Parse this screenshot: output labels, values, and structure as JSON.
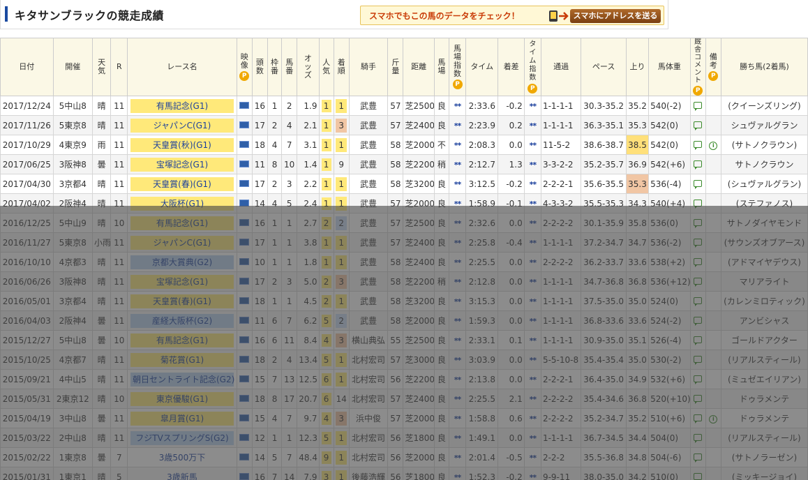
{
  "page": {
    "title": "キタサンブラックの競走成績",
    "banner_text": "スマホでもこの馬のデータをチェック！",
    "banner_button": "スマホにアドレスを送る",
    "p_badge": "P"
  },
  "colors": {
    "accent": "#1b4aa0",
    "highlight_yellow": "#ffe97a",
    "header_bg": "#fbf8e6",
    "link": "#1a3f9c"
  },
  "columns": {
    "date": "日付",
    "venue": "開催",
    "weather": "天気",
    "race_no": "R",
    "race_name": "レース名",
    "video": "映像",
    "field": "頭数",
    "waku": "枠番",
    "umaban": "馬番",
    "odds": "オッズ",
    "ninki": "人気",
    "chakujun": "着順",
    "jockey": "騎手",
    "kinryo": "斤量",
    "distance": "距離",
    "baba": "馬場",
    "baba_index": "馬場指数",
    "time": "タイム",
    "margin": "着差",
    "time_index": "タイム指数",
    "passing": "通過",
    "pace": "ペース",
    "agari": "上り",
    "weight": "馬体重",
    "comment": "厩舎コメント",
    "note": "備考",
    "winner": "勝ち馬(2着馬)"
  },
  "rows": [
    {
      "date": "2017/12/24",
      "venue": "5中山8",
      "weather": "晴",
      "r": "11",
      "name": "有馬記念(G1)",
      "grade": "g1",
      "field": "16",
      "waku": "1",
      "umaban": "2",
      "odds": "1.9",
      "ninki": "1",
      "chaku": "1",
      "chaku_cls": "win",
      "jockey": "武豊",
      "kinryo": "57",
      "distance": "芝2500",
      "baba": "良",
      "bidx": "**",
      "time": "2:33.6",
      "margin": "-0.2",
      "tidx": "**",
      "passing": "1-1-1-1",
      "pace": "30.3-35.2",
      "agari": "35.2",
      "agari_cls": "",
      "weight": "540(-2)",
      "note": "",
      "winner": "(クイーンズリング)"
    },
    {
      "date": "2017/11/26",
      "venue": "5東京8",
      "weather": "晴",
      "r": "11",
      "name": "ジャパンC(G1)",
      "grade": "g1",
      "field": "17",
      "waku": "2",
      "umaban": "4",
      "odds": "2.1",
      "ninki": "1",
      "chaku": "3",
      "chaku_cls": "third",
      "jockey": "武豊",
      "kinryo": "57",
      "distance": "芝2400",
      "baba": "良",
      "bidx": "**",
      "time": "2:23.9",
      "margin": "0.2",
      "tidx": "**",
      "passing": "1-1-1-1",
      "pace": "36.3-35.1",
      "agari": "35.3",
      "agari_cls": "",
      "weight": "542(0)",
      "note": "",
      "winner": "シュヴァルグラン"
    },
    {
      "date": "2017/10/29",
      "venue": "4東京9",
      "weather": "雨",
      "r": "11",
      "name": "天皇賞(秋)(G1)",
      "grade": "g1",
      "field": "18",
      "waku": "4",
      "umaban": "7",
      "odds": "3.1",
      "ninki": "1",
      "chaku": "1",
      "chaku_cls": "win",
      "jockey": "武豊",
      "kinryo": "58",
      "distance": "芝2000",
      "baba": "不",
      "bidx": "**",
      "time": "2:08.3",
      "margin": "0.0",
      "tidx": "**",
      "passing": "11-5-2",
      "pace": "38.6-38.7",
      "agari": "38.5",
      "agari_cls": "agari-hi",
      "weight": "542(0)",
      "note": "i",
      "winner": "(サトノクラウン)"
    },
    {
      "date": "2017/06/25",
      "venue": "3阪神8",
      "weather": "曇",
      "r": "11",
      "name": "宝塚記念(G1)",
      "grade": "g1",
      "field": "11",
      "waku": "8",
      "umaban": "10",
      "odds": "1.4",
      "ninki": "1",
      "chaku": "9",
      "chaku_cls": "",
      "jockey": "武豊",
      "kinryo": "58",
      "distance": "芝2200",
      "baba": "稍",
      "bidx": "**",
      "time": "2:12.7",
      "margin": "1.3",
      "tidx": "**",
      "passing": "3-3-2-2",
      "pace": "35.2-35.7",
      "agari": "36.9",
      "agari_cls": "",
      "weight": "542(+6)",
      "note": "",
      "winner": "サトノクラウン"
    },
    {
      "date": "2017/04/30",
      "venue": "3京都4",
      "weather": "晴",
      "r": "11",
      "name": "天皇賞(春)(G1)",
      "grade": "g1",
      "field": "17",
      "waku": "2",
      "umaban": "3",
      "odds": "2.2",
      "ninki": "1",
      "chaku": "1",
      "chaku_cls": "win",
      "jockey": "武豊",
      "kinryo": "58",
      "distance": "芝3200",
      "baba": "良",
      "bidx": "**",
      "time": "3:12.5",
      "margin": "-0.2",
      "tidx": "**",
      "passing": "2-2-2-1",
      "pace": "35.6-35.5",
      "agari": "35.3",
      "agari_cls": "agari-2",
      "weight": "536(-4)",
      "note": "",
      "winner": "(シュヴァルグラン)"
    },
    {
      "date": "2017/04/02",
      "venue": "2阪神4",
      "weather": "晴",
      "r": "11",
      "name": "大阪杯(G1)",
      "grade": "g1",
      "field": "14",
      "waku": "4",
      "umaban": "5",
      "odds": "2.4",
      "ninki": "1",
      "chaku": "1",
      "chaku_cls": "win",
      "jockey": "武豊",
      "kinryo": "57",
      "distance": "芝2000",
      "baba": "良",
      "bidx": "**",
      "time": "1:58.9",
      "margin": "-0.1",
      "tidx": "**",
      "passing": "4-3-3-2",
      "pace": "35.5-35.3",
      "agari": "34.3",
      "agari_cls": "",
      "weight": "540(+4)",
      "note": "",
      "winner": "(ステファノス)"
    },
    {
      "date": "2016/12/25",
      "venue": "5中山9",
      "weather": "晴",
      "r": "10",
      "name": "有馬記念(G1)",
      "grade": "g1",
      "field": "16",
      "waku": "1",
      "umaban": "1",
      "odds": "2.7",
      "ninki": "2",
      "chaku": "2",
      "chaku_cls": "second",
      "jockey": "武豊",
      "kinryo": "57",
      "distance": "芝2500",
      "baba": "良",
      "bidx": "**",
      "time": "2:32.6",
      "margin": "0.0",
      "tidx": "**",
      "passing": "2-2-2-2",
      "pace": "30.1-35.9",
      "agari": "35.8",
      "agari_cls": "",
      "weight": "536(0)",
      "note": "",
      "winner": "サトノダイヤモンド"
    },
    {
      "date": "2016/11/27",
      "venue": "5東京8",
      "weather": "小雨",
      "r": "11",
      "name": "ジャパンC(G1)",
      "grade": "g1",
      "field": "17",
      "waku": "1",
      "umaban": "1",
      "odds": "3.8",
      "ninki": "1",
      "chaku": "1",
      "chaku_cls": "win",
      "jockey": "武豊",
      "kinryo": "57",
      "distance": "芝2400",
      "baba": "良",
      "bidx": "**",
      "time": "2:25.8",
      "margin": "-0.4",
      "tidx": "**",
      "passing": "1-1-1-1",
      "pace": "37.2-34.7",
      "agari": "34.7",
      "agari_cls": "",
      "weight": "536(-2)",
      "note": "",
      "winner": "(サウンズオブアース)"
    },
    {
      "date": "2016/10/10",
      "venue": "4京都3",
      "weather": "晴",
      "r": "11",
      "name": "京都大賞典(G2)",
      "grade": "g2",
      "field": "10",
      "waku": "1",
      "umaban": "1",
      "odds": "1.8",
      "ninki": "1",
      "chaku": "1",
      "chaku_cls": "win",
      "jockey": "武豊",
      "kinryo": "58",
      "distance": "芝2400",
      "baba": "良",
      "bidx": "**",
      "time": "2:25.5",
      "margin": "0.0",
      "tidx": "**",
      "passing": "2-2-2-2",
      "pace": "36.2-33.7",
      "agari": "33.6",
      "agari_cls": "",
      "weight": "538(+2)",
      "note": "",
      "winner": "(アドマイヤデウス)"
    },
    {
      "date": "2016/06/26",
      "venue": "3阪神8",
      "weather": "晴",
      "r": "11",
      "name": "宝塚記念(G1)",
      "grade": "g1",
      "field": "17",
      "waku": "2",
      "umaban": "3",
      "odds": "5.0",
      "ninki": "2",
      "chaku": "3",
      "chaku_cls": "third",
      "jockey": "武豊",
      "kinryo": "58",
      "distance": "芝2200",
      "baba": "稍",
      "bidx": "**",
      "time": "2:12.8",
      "margin": "0.0",
      "tidx": "**",
      "passing": "1-1-1-1",
      "pace": "34.7-36.8",
      "agari": "36.8",
      "agari_cls": "",
      "weight": "536(+12)",
      "note": "",
      "winner": "マリアライト"
    },
    {
      "date": "2016/05/01",
      "venue": "3京都4",
      "weather": "晴",
      "r": "11",
      "name": "天皇賞(春)(G1)",
      "grade": "g1",
      "field": "18",
      "waku": "1",
      "umaban": "1",
      "odds": "4.5",
      "ninki": "2",
      "chaku": "1",
      "chaku_cls": "win",
      "jockey": "武豊",
      "kinryo": "58",
      "distance": "芝3200",
      "baba": "良",
      "bidx": "**",
      "time": "3:15.3",
      "margin": "0.0",
      "tidx": "**",
      "passing": "1-1-1-1",
      "pace": "37.5-35.0",
      "agari": "35.0",
      "agari_cls": "",
      "weight": "524(0)",
      "note": "",
      "winner": "(カレンミロティック)"
    },
    {
      "date": "2016/04/03",
      "venue": "2阪神4",
      "weather": "曇",
      "r": "11",
      "name": "産経大阪杯(G2)",
      "grade": "g2",
      "field": "11",
      "waku": "6",
      "umaban": "7",
      "odds": "6.2",
      "ninki": "5",
      "chaku": "2",
      "chaku_cls": "second",
      "jockey": "武豊",
      "kinryo": "58",
      "distance": "芝2000",
      "baba": "良",
      "bidx": "**",
      "time": "1:59.3",
      "margin": "0.0",
      "tidx": "**",
      "passing": "1-1-1-1",
      "pace": "36.8-33.6",
      "agari": "33.6",
      "agari_cls": "",
      "weight": "524(-2)",
      "note": "",
      "winner": "アンビシャス"
    },
    {
      "date": "2015/12/27",
      "venue": "5中山8",
      "weather": "曇",
      "r": "10",
      "name": "有馬記念(G1)",
      "grade": "g1",
      "field": "16",
      "waku": "6",
      "umaban": "11",
      "odds": "8.4",
      "ninki": "4",
      "chaku": "3",
      "chaku_cls": "third",
      "jockey": "横山典弘",
      "kinryo": "55",
      "distance": "芝2500",
      "baba": "良",
      "bidx": "**",
      "time": "2:33.1",
      "margin": "0.1",
      "tidx": "**",
      "passing": "1-1-1-1",
      "pace": "30.9-35.0",
      "agari": "35.1",
      "agari_cls": "",
      "weight": "526(-4)",
      "note": "",
      "winner": "ゴールドアクター"
    },
    {
      "date": "2015/10/25",
      "venue": "4京都7",
      "weather": "晴",
      "r": "11",
      "name": "菊花賞(G1)",
      "grade": "g1",
      "field": "18",
      "waku": "2",
      "umaban": "4",
      "odds": "13.4",
      "ninki": "5",
      "chaku": "1",
      "chaku_cls": "win",
      "jockey": "北村宏司",
      "kinryo": "57",
      "distance": "芝3000",
      "baba": "良",
      "bidx": "**",
      "time": "3:03.9",
      "margin": "0.0",
      "tidx": "**",
      "passing": "5-5-10-8",
      "pace": "35.4-35.4",
      "agari": "35.0",
      "agari_cls": "agari-hi",
      "weight": "530(-2)",
      "note": "",
      "winner": "(リアルスティール)"
    },
    {
      "date": "2015/09/21",
      "venue": "4中山5",
      "weather": "晴",
      "r": "11",
      "name": "朝日セントライト記念(G2)",
      "grade": "g2",
      "field": "15",
      "waku": "7",
      "umaban": "13",
      "odds": "12.5",
      "ninki": "6",
      "chaku": "1",
      "chaku_cls": "win",
      "jockey": "北村宏司",
      "kinryo": "56",
      "distance": "芝2200",
      "baba": "良",
      "bidx": "**",
      "time": "2:13.8",
      "margin": "0.0",
      "tidx": "**",
      "passing": "2-2-2-1",
      "pace": "36.4-35.0",
      "agari": "34.9",
      "agari_cls": "",
      "weight": "532(+6)",
      "note": "",
      "winner": "(ミュゼエイリアン)"
    },
    {
      "date": "2015/05/31",
      "venue": "2東京12",
      "weather": "晴",
      "r": "10",
      "name": "東京優駿(G1)",
      "grade": "g1",
      "field": "18",
      "waku": "8",
      "umaban": "17",
      "odds": "20.7",
      "ninki": "6",
      "chaku": "14",
      "chaku_cls": "",
      "jockey": "北村宏司",
      "kinryo": "57",
      "distance": "芝2400",
      "baba": "良",
      "bidx": "**",
      "time": "2:25.5",
      "margin": "2.1",
      "tidx": "**",
      "passing": "2-2-2-2",
      "pace": "35.4-34.6",
      "agari": "36.8",
      "agari_cls": "",
      "weight": "520(+10)",
      "note": "",
      "winner": "ドゥラメンテ"
    },
    {
      "date": "2015/04/19",
      "venue": "3中山8",
      "weather": "曇",
      "r": "11",
      "name": "皐月賞(G1)",
      "grade": "g1",
      "field": "15",
      "waku": "4",
      "umaban": "7",
      "odds": "9.7",
      "ninki": "4",
      "chaku": "3",
      "chaku_cls": "third",
      "jockey": "浜中俊",
      "kinryo": "57",
      "distance": "芝2000",
      "baba": "良",
      "bidx": "**",
      "time": "1:58.8",
      "margin": "0.6",
      "tidx": "**",
      "passing": "2-2-2-2",
      "pace": "35.2-34.7",
      "agari": "35.2",
      "agari_cls": "",
      "weight": "510(+6)",
      "note": "i",
      "winner": "ドゥラメンテ"
    },
    {
      "date": "2015/03/22",
      "venue": "2中山8",
      "weather": "晴",
      "r": "11",
      "name": "フジTVスプリングS(G2)",
      "grade": "g2",
      "field": "12",
      "waku": "1",
      "umaban": "1",
      "odds": "12.3",
      "ninki": "5",
      "chaku": "1",
      "chaku_cls": "win",
      "jockey": "北村宏司",
      "kinryo": "56",
      "distance": "芝1800",
      "baba": "良",
      "bidx": "**",
      "time": "1:49.1",
      "margin": "0.0",
      "tidx": "**",
      "passing": "1-1-1-1",
      "pace": "36.7-34.5",
      "agari": "34.4",
      "agari_cls": "",
      "weight": "504(0)",
      "note": "",
      "winner": "(リアルスティール)"
    },
    {
      "date": "2015/02/22",
      "venue": "1東京8",
      "weather": "曇",
      "r": "7",
      "name": "3歳500万下",
      "grade": "plain",
      "field": "14",
      "waku": "5",
      "umaban": "7",
      "odds": "48.4",
      "ninki": "9",
      "chaku": "1",
      "chaku_cls": "win",
      "jockey": "北村宏司",
      "kinryo": "56",
      "distance": "芝2000",
      "baba": "良",
      "bidx": "**",
      "time": "2:01.4",
      "margin": "-0.5",
      "tidx": "**",
      "passing": "2-2-2",
      "pace": "35.5-36.8",
      "agari": "34.8",
      "agari_cls": "",
      "weight": "504(-6)",
      "note": "",
      "winner": "(サトノラーゼン)"
    },
    {
      "date": "2015/01/31",
      "venue": "1東京1",
      "weather": "晴",
      "r": "5",
      "name": "3歳新馬",
      "grade": "plain",
      "field": "16",
      "waku": "7",
      "umaban": "14",
      "odds": "7.9",
      "ninki": "3",
      "chaku": "1",
      "chaku_cls": "win",
      "jockey": "後藤浩輝",
      "kinryo": "56",
      "distance": "芝1800",
      "baba": "良",
      "bidx": "**",
      "time": "1:52.3",
      "margin": "-0.2",
      "tidx": "**",
      "passing": "9-9-11",
      "pace": "38.0-35.0",
      "agari": "34.2",
      "agari_cls": "agari-3",
      "weight": "510(0)",
      "note": "",
      "winner": "(ミッキージョイ)"
    }
  ]
}
